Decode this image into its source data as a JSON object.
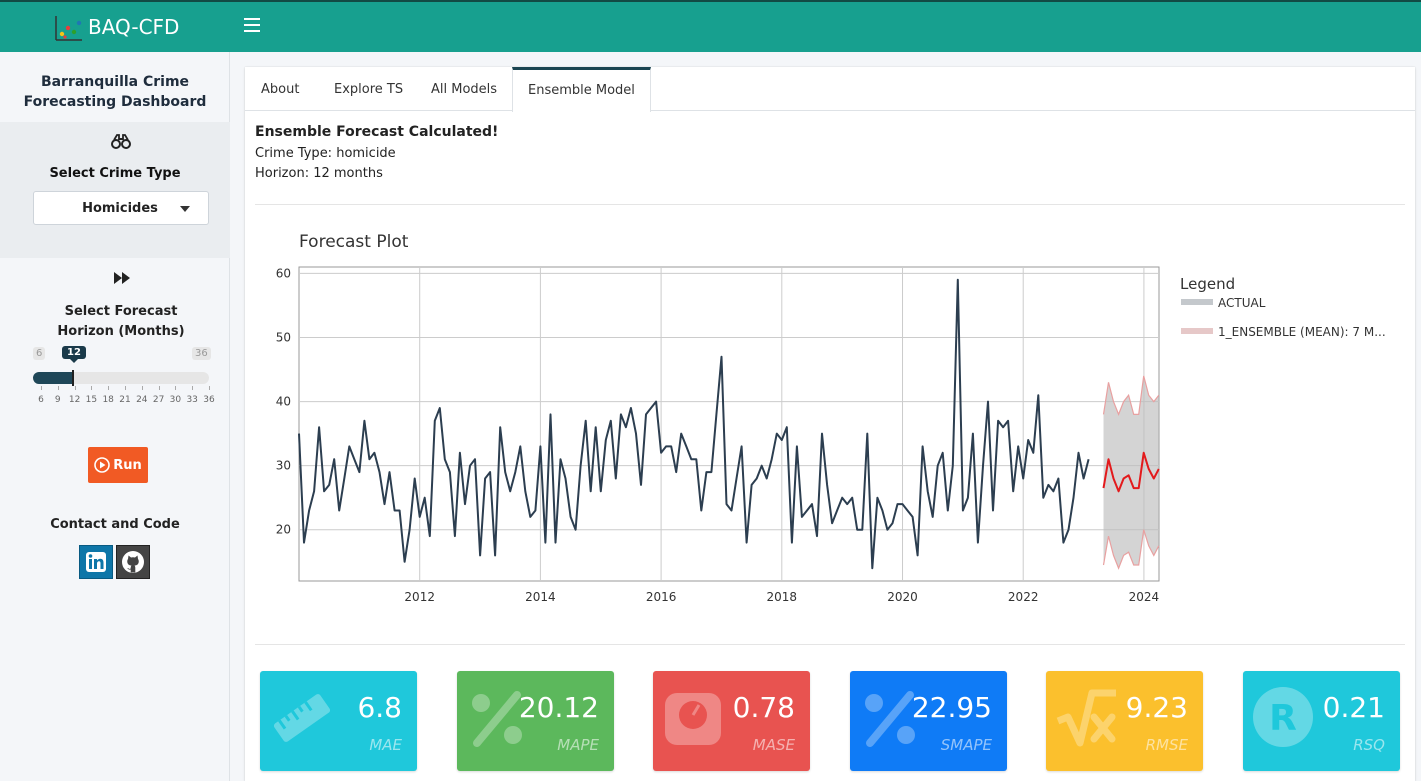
{
  "app": {
    "brand": "BAQ-CFD"
  },
  "sidebar": {
    "title": "Barranquilla Crime Forecasting Dashboard",
    "crime_label": "Select Crime Type",
    "crime_value": "Homicides",
    "horizon_label": "Select Forecast Horizon (Months)",
    "slider": {
      "min": "6",
      "max": "36",
      "value": "12",
      "ticks": [
        "6",
        "9",
        "12",
        "15",
        "18",
        "21",
        "24",
        "27",
        "30",
        "33",
        "36"
      ],
      "fraction": 0.2
    },
    "run_label": "Run",
    "contact_label": "Contact and Code"
  },
  "tabs": [
    "About",
    "Explore TS",
    "All Models",
    "Ensemble Model"
  ],
  "message": {
    "title": "Ensemble Forecast Calculated!",
    "crime_line": "Crime Type: homicide",
    "horizon_line": "Horizon: 12 months"
  },
  "metrics": [
    {
      "value": "6.8",
      "label": "MAE",
      "color": "#1fc8db",
      "icon": "ruler-icon"
    },
    {
      "value": "20.12",
      "label": "MAPE",
      "color": "#5cb85c",
      "icon": "percent-icon"
    },
    {
      "value": "0.78",
      "label": "MASE",
      "color": "#e85350",
      "icon": "scale-icon"
    },
    {
      "value": "22.95",
      "label": "SMAPE",
      "color": "#0f7bf6",
      "icon": "percent-icon"
    },
    {
      "value": "9.23",
      "label": "RMSE",
      "color": "#fbc02d",
      "icon": "square-root-icon"
    },
    {
      "value": "0.21",
      "label": "RSQ",
      "color": "#1fc8db",
      "icon": "r-letter-icon"
    }
  ],
  "chart_data": {
    "type": "line",
    "title": "Forecast Plot",
    "legend_title": "Legend",
    "legend_position": "right",
    "xlim": [
      2010.0,
      2024.25
    ],
    "ylim": [
      12,
      61
    ],
    "xticks": [
      2012,
      2014,
      2016,
      2018,
      2020,
      2022,
      2024
    ],
    "yticks": [
      20,
      30,
      40,
      50,
      60
    ],
    "grid": true,
    "actual": {
      "name": "ACTUAL",
      "color": "#2c3e50",
      "start": 2010.0,
      "step": 0.0833333,
      "values": [
        35,
        18,
        23,
        26,
        36,
        26,
        27,
        31,
        23,
        28,
        33,
        31,
        29,
        37,
        31,
        32,
        29,
        24,
        29,
        23,
        23,
        15,
        20,
        28,
        22,
        25,
        19,
        37,
        39,
        31,
        29,
        19,
        32,
        24,
        30,
        31,
        16,
        28,
        29,
        16,
        36,
        29,
        26,
        29,
        33,
        26,
        22,
        23,
        33,
        18,
        38,
        18,
        31,
        28,
        22,
        20,
        30,
        37,
        26,
        36,
        26,
        34,
        37,
        28,
        38,
        36,
        39,
        35,
        27,
        38,
        39,
        40,
        32,
        33,
        33,
        29,
        35,
        33,
        31,
        31,
        23,
        29,
        29,
        38,
        47,
        24,
        23,
        28,
        33,
        18,
        27,
        28,
        30,
        28,
        31,
        35,
        34,
        36,
        18,
        33,
        22,
        23,
        24,
        19,
        35,
        27,
        21,
        23,
        25,
        24,
        25,
        20,
        20,
        35,
        14,
        25,
        23,
        20,
        21,
        24,
        24,
        23,
        22,
        16,
        33,
        26,
        22,
        30,
        32,
        23,
        30,
        59,
        23,
        25,
        35,
        18,
        30,
        40,
        23,
        37,
        36,
        37,
        26,
        33,
        28,
        34,
        32,
        41,
        25,
        27,
        26,
        28,
        18,
        20,
        25,
        32,
        28,
        31
      ]
    },
    "forecast": {
      "name": "1_ENSEMBLE (MEAN): 7 M...",
      "color": "#e31a1c",
      "start": 2023.33,
      "step": 0.0833333,
      "mean": [
        26.5,
        31,
        28,
        26,
        28,
        28.5,
        26.5,
        26.5,
        32,
        29.5,
        28,
        29.5
      ],
      "upper": [
        38,
        43,
        40,
        38,
        40,
        41,
        38,
        38,
        44,
        41,
        40,
        41
      ],
      "lower": [
        14.5,
        19,
        16,
        14,
        16,
        16.5,
        14.5,
        14.5,
        20,
        17.5,
        16,
        17.5
      ]
    }
  }
}
